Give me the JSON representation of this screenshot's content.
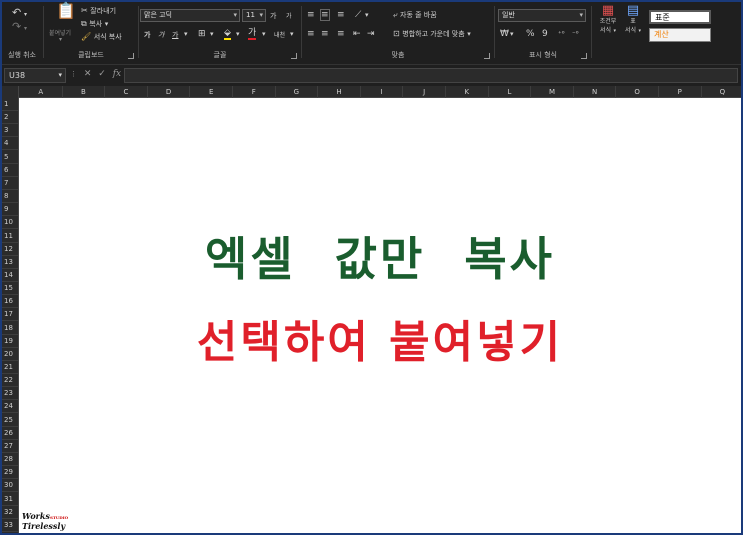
{
  "ribbon": {
    "undo_group": {
      "label": "실행 취소",
      "undo_icon": "undo-icon",
      "redo_icon": "redo-icon"
    },
    "clipboard": {
      "label": "클립보드",
      "paste": "붙여넣기",
      "cut": "잘라내기",
      "copy": "복사",
      "format_painter": "서식 복사"
    },
    "font": {
      "label": "글꼴",
      "font_name": "맑은 고딕",
      "font_size": "11",
      "grow": "가",
      "shrink": "가",
      "bold": "가",
      "italic": "가",
      "underline": "가",
      "phonetic": "내천"
    },
    "alignment": {
      "label": "맞춤",
      "wrap_text": "자동 줄 바꿈",
      "merge_center": "병합하고 가운데 맞춤"
    },
    "number": {
      "label": "표시 형식",
      "format": "일반",
      "percent": "%"
    },
    "styles": {
      "conditional": [
        "조건부",
        "서식"
      ],
      "table": [
        "표",
        "서식"
      ],
      "normal": "표준",
      "calc": "계산"
    }
  },
  "formula_bar": {
    "name_box": "U38",
    "fx": "fx",
    "value": ""
  },
  "columns": [
    "A",
    "B",
    "C",
    "D",
    "E",
    "F",
    "G",
    "H",
    "I",
    "J",
    "K",
    "L",
    "M",
    "N",
    "O",
    "P",
    "Q"
  ],
  "rows": [
    "1",
    "2",
    "3",
    "4",
    "5",
    "6",
    "7",
    "8",
    "9",
    "10",
    "11",
    "12",
    "13",
    "14",
    "15",
    "16",
    "17",
    "18",
    "19",
    "20",
    "21",
    "22",
    "23",
    "24",
    "25",
    "26",
    "27",
    "28",
    "29",
    "30",
    "31",
    "32",
    "33"
  ],
  "sheet": {
    "title_line1": "엑셀   값만 복사",
    "title_line2": "선택하여 붙여넣기"
  },
  "logo": {
    "line1": "Works",
    "tag": "STUDIO",
    "line2": "Tirelessly"
  },
  "colors": {
    "green": "#1a5d2e",
    "red": "#e0202a",
    "calc_orange": "#f07d00"
  }
}
